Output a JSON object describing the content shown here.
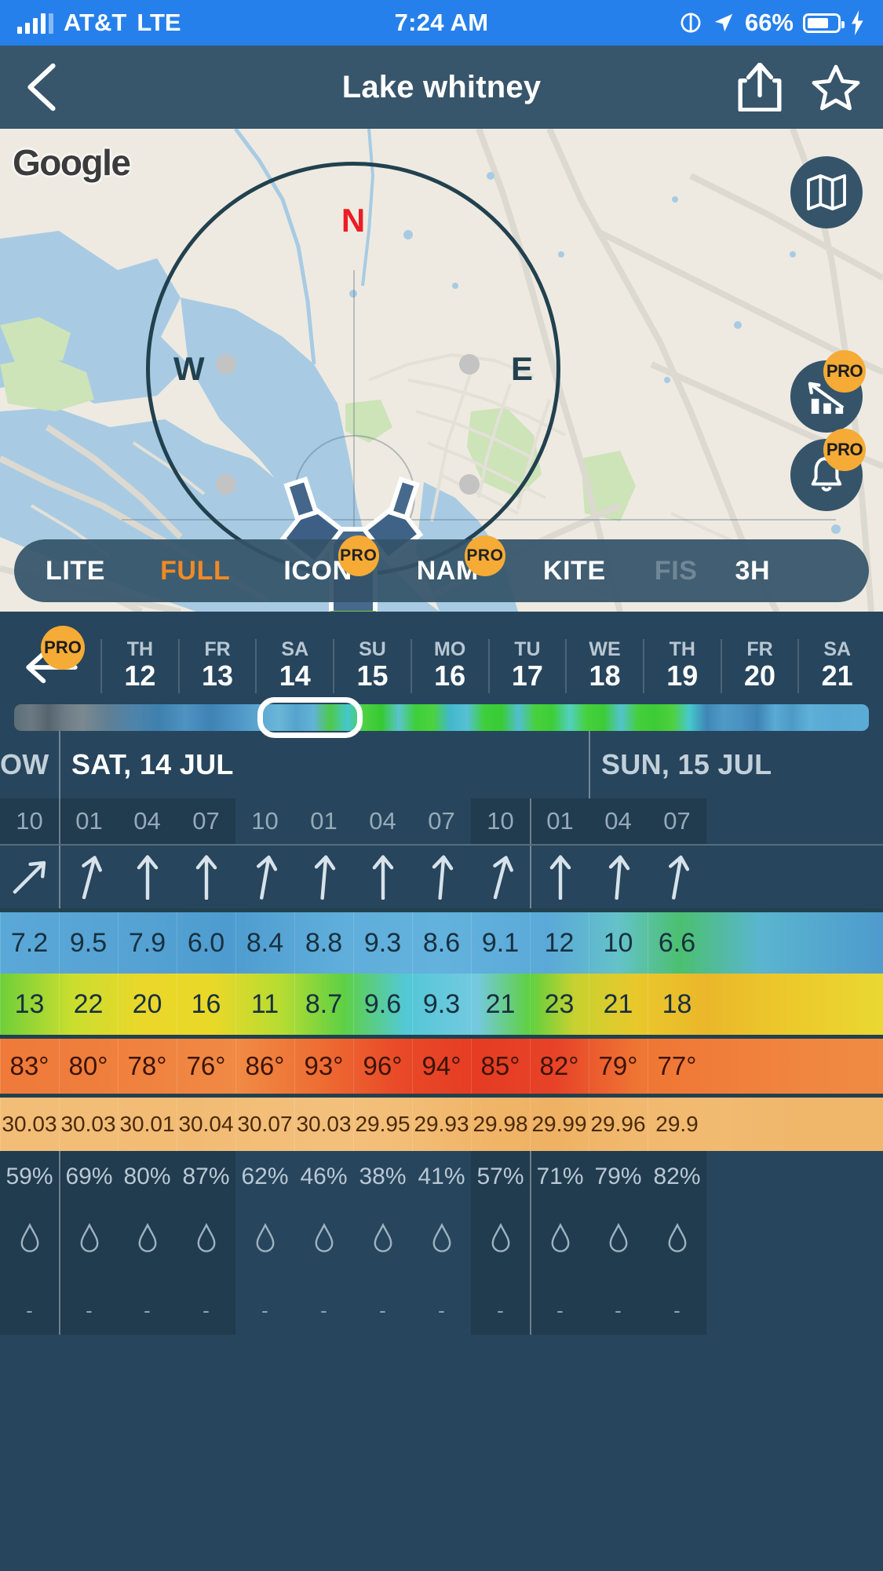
{
  "status_bar": {
    "carrier": "AT&T",
    "network": "LTE",
    "time": "7:24 AM",
    "battery_percent": "66%",
    "icons": [
      "signal-icon",
      "do-not-disturb-icon",
      "location-arrow-icon",
      "battery-icon",
      "charging-bolt-icon"
    ]
  },
  "nav": {
    "back_icon": "chevron-left-icon",
    "title": "Lake whitney",
    "share_icon": "share-icon",
    "favorite_icon": "star-outline-icon"
  },
  "map": {
    "attribution": "Google",
    "compass": {
      "north": "N",
      "west": "W",
      "east": "E"
    },
    "buttons": [
      {
        "name": "map-layer-button",
        "icon": "folded-map-icon",
        "pro": false
      },
      {
        "name": "stats-button",
        "icon": "bar-chart-icon",
        "pro": true,
        "badge": "PRO"
      },
      {
        "name": "alerts-button",
        "icon": "bell-icon",
        "pro": true,
        "badge": "PRO"
      }
    ]
  },
  "model_bar": {
    "items": [
      {
        "label": "LITE",
        "state": "normal",
        "pro": false
      },
      {
        "label": "FULL",
        "state": "active",
        "pro": false
      },
      {
        "label": "ICON",
        "state": "normal",
        "pro": true,
        "badge": "PRO"
      },
      {
        "label": "NAM",
        "state": "normal",
        "pro": true,
        "badge": "PRO"
      },
      {
        "label": "KITE",
        "state": "normal",
        "pro": false
      },
      {
        "label": "FIS",
        "state": "disabled",
        "pro": false
      },
      {
        "label": "3H",
        "state": "normal",
        "pro": false
      }
    ],
    "settings_icon": "gear-icon",
    "close_icon": "close-icon"
  },
  "timeline": {
    "back_icon": "arrow-left-icon",
    "back_badge": "PRO",
    "days": [
      {
        "weekday": "TH",
        "day": "12"
      },
      {
        "weekday": "FR",
        "day": "13"
      },
      {
        "weekday": "SA",
        "day": "14"
      },
      {
        "weekday": "SU",
        "day": "15"
      },
      {
        "weekday": "MO",
        "day": "16"
      },
      {
        "weekday": "TU",
        "day": "17"
      },
      {
        "weekday": "WE",
        "day": "18"
      },
      {
        "weekday": "TH",
        "day": "19"
      },
      {
        "weekday": "FR",
        "day": "20"
      },
      {
        "weekday": "SA",
        "day": "21"
      }
    ],
    "selected_day": "14"
  },
  "forecast": {
    "day_headers": [
      {
        "label": "OW",
        "truncated": true
      },
      {
        "label": "SAT, 14 JUL",
        "active": true
      },
      {
        "label": "SUN, 15 JUL",
        "active": false
      }
    ],
    "hours": [
      "10",
      "01",
      "04",
      "07",
      "10",
      "01",
      "04",
      "07",
      "10",
      "01",
      "04",
      "07"
    ],
    "wind_direction_deg": [
      45,
      15,
      0,
      0,
      10,
      5,
      0,
      5,
      15,
      0,
      5,
      10
    ],
    "wind_speed": [
      "7.2",
      "9.5",
      "7.9",
      "6.0",
      "8.4",
      "8.8",
      "9.3",
      "8.6",
      "9.1",
      "12",
      "10",
      "6.6"
    ],
    "wind_gust": [
      "13",
      "22",
      "20",
      "16",
      "11",
      "8.7",
      "9.6",
      "9.3",
      "21",
      "23",
      "21",
      "18"
    ],
    "temperature": [
      "83°",
      "80°",
      "78°",
      "76°",
      "86°",
      "93°",
      "96°",
      "94°",
      "85°",
      "82°",
      "79°",
      "77°"
    ],
    "pressure": [
      "30.03",
      "30.03",
      "30.01",
      "30.04",
      "30.07",
      "30.03",
      "29.95",
      "29.93",
      "29.98",
      "29.99",
      "29.96",
      "29.9"
    ],
    "humidity": [
      "59%",
      "69%",
      "80%",
      "87%",
      "62%",
      "46%",
      "38%",
      "41%",
      "57%",
      "71%",
      "79%",
      "82%"
    ],
    "precip_icon": "water-drop-icon",
    "precip": [
      "-",
      "-",
      "-",
      "-",
      "-",
      "-",
      "-",
      "-",
      "-",
      "-",
      "-",
      "-"
    ],
    "wind_speed_colors": [
      "#5aa8d8",
      "#58a6d6",
      "#57a4d4",
      "#4e9ccf",
      "#5fadda",
      "#63b2dd",
      "#61afdb",
      "#5ba9d8",
      "#6fc0cf",
      "#4cc070",
      "#5ab5cf",
      "#4e9bcd"
    ],
    "wind_gust_colors": [
      "#6ece3a",
      "#eadf2a",
      "#ead828",
      "#b5dc33",
      "#4ece49",
      "#6cc7de",
      "#74c9e0",
      "#5fd040",
      "#e9c82c",
      "#eab72a",
      "#ecc72b",
      "#ead832"
    ],
    "temperature_colors": [
      "#ef7a3a",
      "#ef7d3c",
      "#f08340",
      "#f08a44",
      "#ee6e33",
      "#e94a28",
      "#e53c23",
      "#e74328",
      "#ef7533",
      "#f07d3a",
      "#f0853f",
      "#f08b43"
    ],
    "pressure_colors": [
      "#f2bd76",
      "#f2bd76",
      "#f1bb74",
      "#f2be78",
      "#f3c07c",
      "#f2bd76",
      "#f0b568",
      "#efb264",
      "#f1b96f",
      "#f1ba71",
      "#f0b76b",
      "#f0b76b"
    ],
    "cell_night_flags": [
      true,
      true,
      true,
      true,
      false,
      false,
      false,
      false,
      true,
      true,
      true,
      true
    ]
  },
  "colors": {
    "accent": "#f08a24",
    "pro_badge": "#f5ab35",
    "nav_bg": "#37556b",
    "body_bg": "#27455c",
    "status_bg": "#2680eb",
    "north_marker": "#ec1c24"
  }
}
